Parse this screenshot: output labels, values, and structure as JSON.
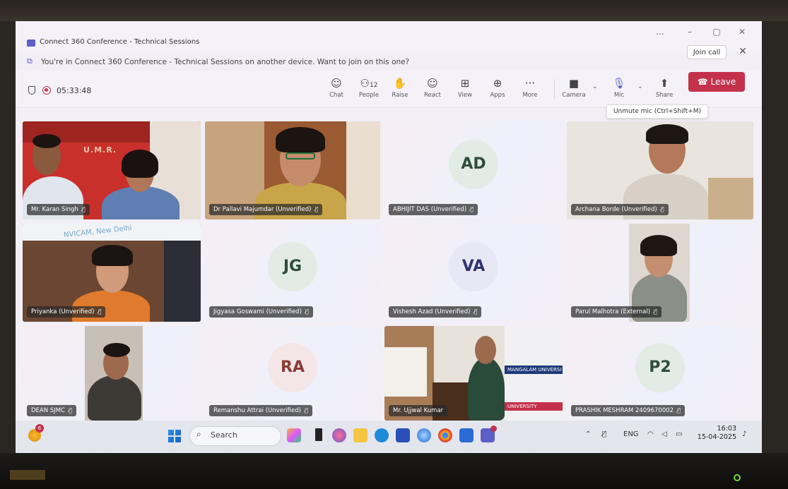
{
  "window": {
    "title": "Connect 360 Conference - Technical Sessions",
    "controls": [
      "...",
      "–",
      "▢",
      "✕"
    ]
  },
  "notice": {
    "text": "You're in Connect 360 Conference - Technical Sessions on another device. Want to join on this one?",
    "join_label": "Join call",
    "close": "✕"
  },
  "toolbar": {
    "timer": "05:33:48",
    "people_count": "12",
    "buttons": {
      "chat": "Chat",
      "people": "People",
      "raise": "Raise",
      "react": "React",
      "view": "View",
      "apps": "Apps",
      "more": "More",
      "camera": "Camera",
      "mic": "Mic",
      "share": "Share"
    },
    "leave_label": "Leave",
    "tooltip": "Unmute mic (Ctrl+Shift+M)"
  },
  "participants": [
    {
      "name": "Mr. Karan Singh",
      "type": "video"
    },
    {
      "name": "Dr Pallavi Majumdar (Unverified)",
      "type": "video"
    },
    {
      "name": "ABHIJIT DAS (Unverified)",
      "type": "avatar",
      "initials": "AD"
    },
    {
      "name": "Archana Borde (Unverified)",
      "type": "video"
    },
    {
      "name": "Priyanka (Unverified)",
      "type": "video"
    },
    {
      "name": "Jigyasa Goswami (Unverified)",
      "type": "avatar",
      "initials": "JG"
    },
    {
      "name": "Vishesh Azad (Unverified)",
      "type": "avatar",
      "initials": "VA"
    },
    {
      "name": "Parul Malhotra (External)",
      "type": "video"
    },
    {
      "name": "DEAN SJMC",
      "type": "video"
    },
    {
      "name": "Remanshu Attrai (Unverified)",
      "type": "avatar",
      "initials": "RA"
    },
    {
      "name": "Mr. Ujjwal Kumar",
      "type": "video"
    },
    {
      "name": "PRASHIK MESHRAM 2409670002",
      "type": "avatar",
      "initials": "P2"
    }
  ],
  "backgrounds": {
    "karan_wall_sign": "U.M.R.",
    "priyanka_sign": "NVICAM, New Delhi",
    "ujjwal_banner": "MANGALAM UNIVERSI",
    "ujjwal_podium": "UNIVERSITY"
  },
  "taskbar": {
    "search_placeholder": "Search",
    "notification_count": "6",
    "language": "ENG",
    "time": "16:03",
    "date": "15-04-2025"
  },
  "colors": {
    "leave": "#c4314b",
    "accent": "#5b5fc7"
  }
}
